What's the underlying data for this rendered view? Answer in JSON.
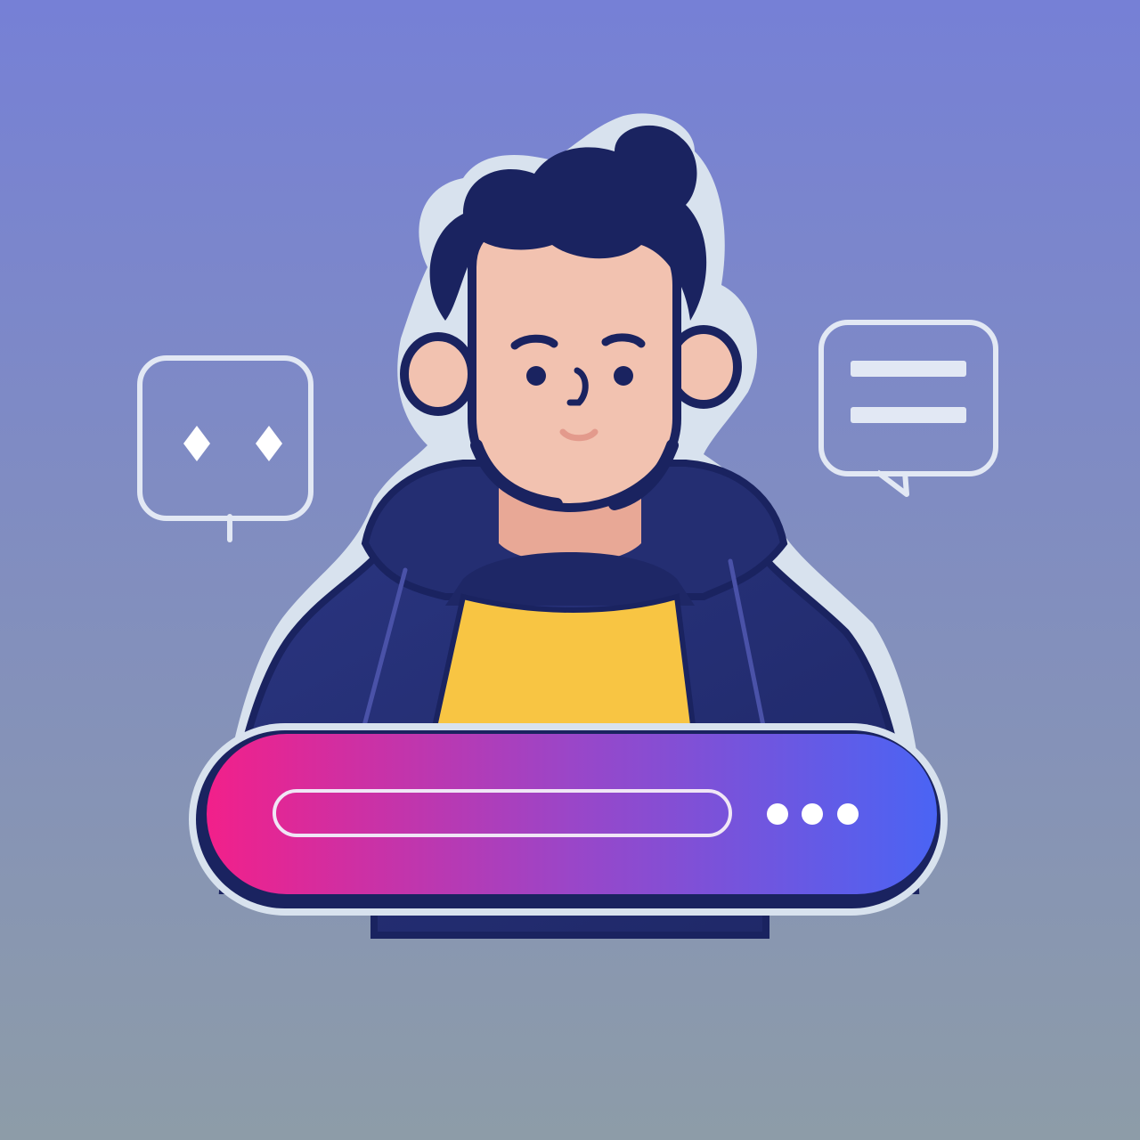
{
  "colors": {
    "bg_top": "#7680D6",
    "bg_bottom": "#8D9CA8",
    "outline": "#D8E2EE",
    "navy": "#1A2360",
    "hoodie": "#242E72",
    "hoodie_shadow": "#1A2360",
    "hoodie_seam": "#4A52A8",
    "skin": "#F2C2B0",
    "skin_shadow": "#E8A896",
    "shirt": "#F8C543",
    "mouth": "#E39A8C",
    "bar_left": "#F2208A",
    "bar_mid": "#9A46C8",
    "bar_right": "#4A64F4",
    "bubble_stroke": "#E2E8F4",
    "white": "#FFFFFF"
  },
  "icons": {
    "left_bubble": "chat-bubble-icon",
    "right_bubble": "message-lines-icon",
    "more": "ellipsis-icon"
  },
  "search_bar": {
    "placeholder": "",
    "dots_count": 3
  }
}
